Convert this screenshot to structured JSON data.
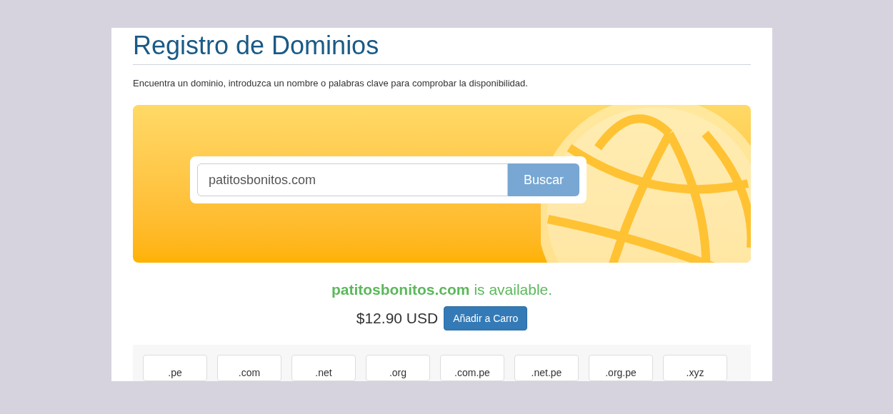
{
  "title": "Registro de Dominios",
  "description": "Encuentra un dominio, introduzca un nombre o palabras clave para comprobar la disponibilidad.",
  "search": {
    "value": "patitosbonitos.com",
    "button": "Buscar"
  },
  "result": {
    "domain": "patitosbonitos.com",
    "status": "is available.",
    "price": "$12.90 USD",
    "button": "Añadir a Carro"
  },
  "tlds": [
    {
      "label": ".pe"
    },
    {
      "label": ".com"
    },
    {
      "label": ".net"
    },
    {
      "label": ".org"
    },
    {
      "label": ".com.pe"
    },
    {
      "label": ".net.pe"
    },
    {
      "label": ".org.pe"
    },
    {
      "label": ".xyz"
    }
  ]
}
